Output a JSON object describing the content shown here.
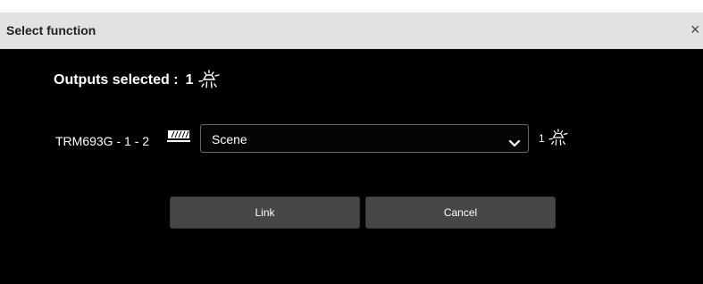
{
  "dialog": {
    "title": "Select function",
    "close_glyph": "×"
  },
  "outputs": {
    "label": "Outputs selected :",
    "count": "1",
    "icon": "light-bulb-icon"
  },
  "device": {
    "label": "TRM693G - 1 - 2",
    "type_icon": "shutter-icon",
    "function_select": {
      "selected": "Scene",
      "options": [
        "Scene"
      ]
    },
    "output_count": "1",
    "output_icon": "light-bulb-icon"
  },
  "buttons": {
    "link_label": "Link",
    "cancel_label": "Cancel"
  }
}
